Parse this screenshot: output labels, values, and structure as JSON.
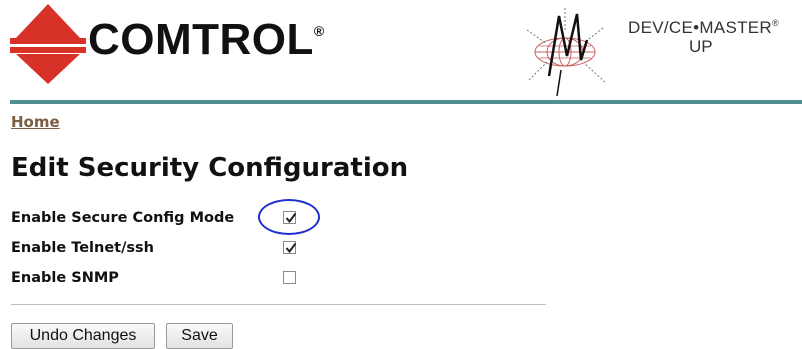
{
  "header": {
    "brand_name": "COMTROL",
    "brand_registered": "®",
    "product_line1": "DEV/CE•MASTER",
    "product_registered": "®",
    "product_line2": "UP",
    "rule_color": "#4e8f94",
    "brand_color": "#d83228"
  },
  "nav": {
    "home_label": "Home"
  },
  "page": {
    "title": "Edit Security Configuration"
  },
  "settings": [
    {
      "label": "Enable Secure Config Mode",
      "checked": true,
      "highlighted": true
    },
    {
      "label": "Enable Telnet/ssh",
      "checked": true,
      "highlighted": false
    },
    {
      "label": "Enable SNMP",
      "checked": false,
      "highlighted": false
    }
  ],
  "buttons": {
    "undo_label": "Undo Changes",
    "save_label": "Save"
  },
  "icons": {
    "brand_mark": "comtrol-arrow-logo-icon",
    "product_mark": "devicemaster-globe-logo-icon",
    "checkbox_checked": "check-icon",
    "annotation": "highlight-ellipse"
  }
}
